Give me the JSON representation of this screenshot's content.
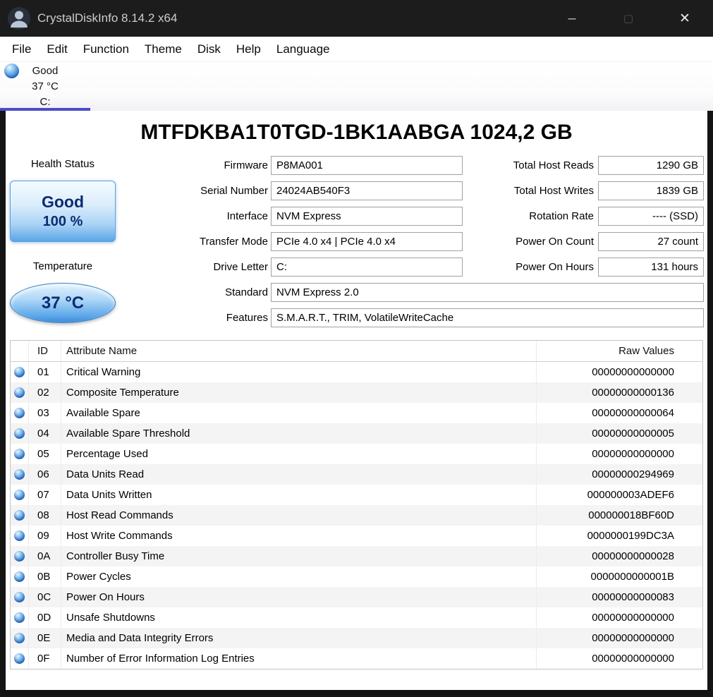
{
  "window": {
    "title": "CrystalDiskInfo 8.14.2 x64",
    "controls": {
      "minimize": "–",
      "maximize": "▢",
      "close": "✕"
    }
  },
  "menu": {
    "items": [
      "File",
      "Edit",
      "Function",
      "Theme",
      "Disk",
      "Help",
      "Language"
    ]
  },
  "drive_tab": {
    "status": "Good",
    "temperature": "37 °C",
    "letter": "C:"
  },
  "main": {
    "model_title": "MTFDKBA1T0TGD-1BK1AABGA 1024,2 GB",
    "health": {
      "label": "Health Status",
      "status": "Good",
      "percent": "100 %"
    },
    "temperature": {
      "label": "Temperature",
      "value": "37 °C"
    },
    "info": [
      {
        "label": "Firmware",
        "value": "P8MA001"
      },
      {
        "label": "Serial Number",
        "value": "24024AB540F3"
      },
      {
        "label": "Interface",
        "value": "NVM Express"
      },
      {
        "label": "Transfer Mode",
        "value": "PCIe 4.0 x4 | PCIe 4.0 x4"
      },
      {
        "label": "Drive Letter",
        "value": "C:"
      },
      {
        "label": "Standard",
        "value": "NVM Express 2.0"
      },
      {
        "label": "Features",
        "value": "S.M.A.R.T., TRIM, VolatileWriteCache"
      }
    ],
    "info_right": [
      {
        "label": "Total Host Reads",
        "value": "1290 GB"
      },
      {
        "label": "Total Host Writes",
        "value": "1839 GB"
      },
      {
        "label": "Rotation Rate",
        "value": "---- (SSD)"
      },
      {
        "label": "Power On Count",
        "value": "27 count"
      },
      {
        "label": "Power On Hours",
        "value": "131 hours"
      }
    ]
  },
  "smart_table": {
    "headers": {
      "id": "ID",
      "name": "Attribute Name",
      "raw": "Raw Values"
    },
    "rows": [
      {
        "id": "01",
        "name": "Critical Warning",
        "raw": "00000000000000"
      },
      {
        "id": "02",
        "name": "Composite Temperature",
        "raw": "00000000000136"
      },
      {
        "id": "03",
        "name": "Available Spare",
        "raw": "00000000000064"
      },
      {
        "id": "04",
        "name": "Available Spare Threshold",
        "raw": "00000000000005"
      },
      {
        "id": "05",
        "name": "Percentage Used",
        "raw": "00000000000000"
      },
      {
        "id": "06",
        "name": "Data Units Read",
        "raw": "00000000294969"
      },
      {
        "id": "07",
        "name": "Data Units Written",
        "raw": "000000003ADEF6"
      },
      {
        "id": "08",
        "name": "Host Read Commands",
        "raw": "000000018BF60D"
      },
      {
        "id": "09",
        "name": "Host Write Commands",
        "raw": "0000000199DC3A"
      },
      {
        "id": "0A",
        "name": "Controller Busy Time",
        "raw": "00000000000028"
      },
      {
        "id": "0B",
        "name": "Power Cycles",
        "raw": "0000000000001B"
      },
      {
        "id": "0C",
        "name": "Power On Hours",
        "raw": "00000000000083"
      },
      {
        "id": "0D",
        "name": "Unsafe Shutdowns",
        "raw": "00000000000000"
      },
      {
        "id": "0E",
        "name": "Media and Data Integrity Errors",
        "raw": "00000000000000"
      },
      {
        "id": "0F",
        "name": "Number of Error Information Log Entries",
        "raw": "00000000000000"
      }
    ]
  },
  "colors": {
    "tab_accent": "#4b4bcb",
    "health_good_blue": "#5aa5e6",
    "status_orb_blue": "#2f7ad4",
    "titlebar_bg": "#1c1c1c"
  }
}
